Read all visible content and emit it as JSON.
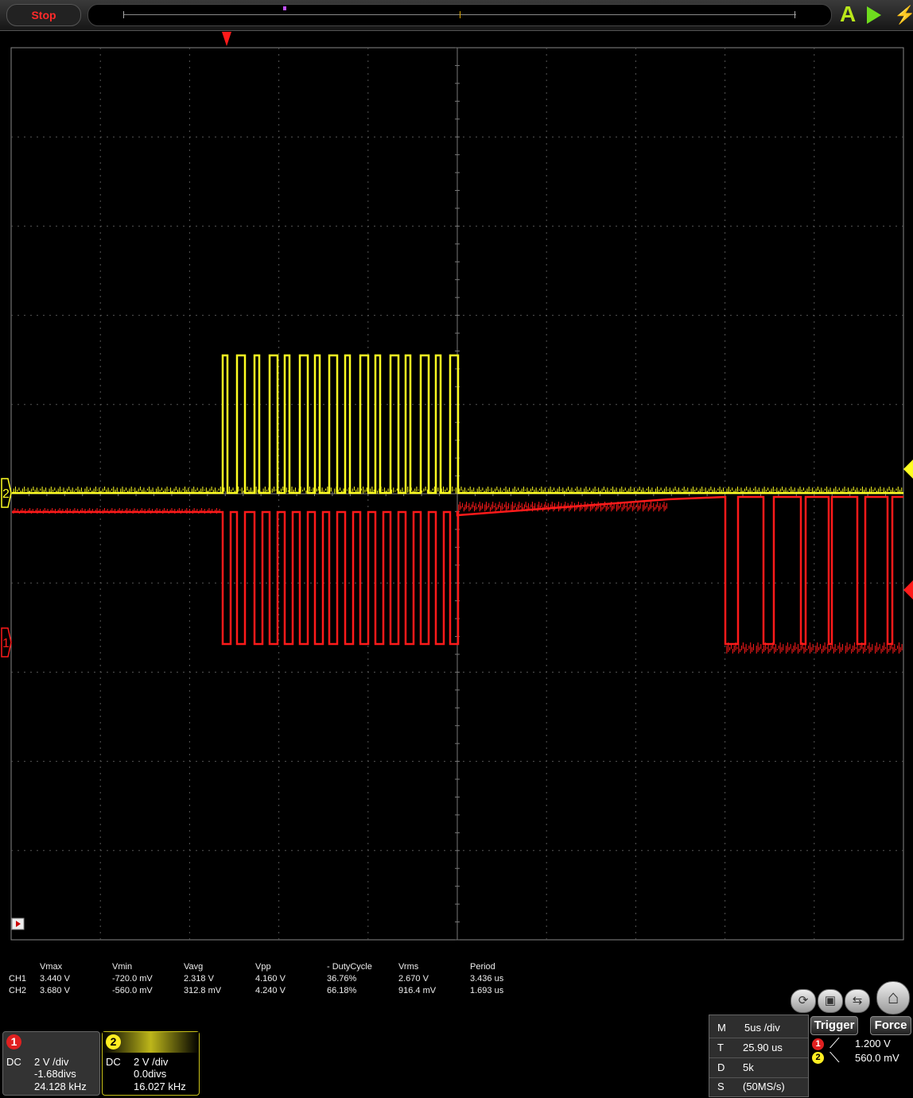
{
  "topbar": {
    "stop_label": "Stop",
    "auto_label": "A",
    "run_icon": "play-icon",
    "single_icon": "lightning-icon"
  },
  "channels": [
    {
      "id": "1",
      "coupling": "DC",
      "scale": "2 V /div",
      "offset": "-1.68divs",
      "freq": "24.128 kHz",
      "color": "#ff1a1a"
    },
    {
      "id": "2",
      "coupling": "DC",
      "scale": "2 V /div",
      "offset": "0.0divs",
      "freq": "16.027 kHz",
      "color": "#ffff22"
    }
  ],
  "measurements": {
    "headers": [
      "Vmax",
      "Vmin",
      "Vavg",
      "Vpp",
      "- DutyCycle",
      "Vrms",
      "Period"
    ],
    "rows": [
      {
        "label": "CH1",
        "values": [
          "3.440 V",
          "-720.0 mV",
          "2.318 V",
          "4.160 V",
          "36.76%",
          "2.670 V",
          "3.436 us"
        ]
      },
      {
        "label": "CH2",
        "values": [
          "3.680 V",
          "-560.0 mV",
          "312.8 mV",
          "4.240 V",
          "66.18%",
          "916.4 mV",
          "1.693 us"
        ]
      }
    ]
  },
  "toolbar": {
    "icons": [
      "autoset-icon",
      "save-icon",
      "display-mode-icon",
      "home-icon"
    ]
  },
  "timebase": {
    "rows": [
      {
        "key": "M",
        "value": "5us /div"
      },
      {
        "key": "T",
        "value": "25.90 us"
      },
      {
        "key": "D",
        "value": "5k"
      },
      {
        "key": "S",
        "value": "(50MS/s)"
      }
    ]
  },
  "trigger": {
    "trigger_label": "Trigger",
    "force_label": "Force",
    "levels": [
      {
        "ch": "1",
        "value": "1.200 V"
      },
      {
        "ch": "2",
        "value": "560.0 mV"
      }
    ]
  },
  "waveform": {
    "ch1_marker": "1",
    "ch2_marker": "2"
  }
}
